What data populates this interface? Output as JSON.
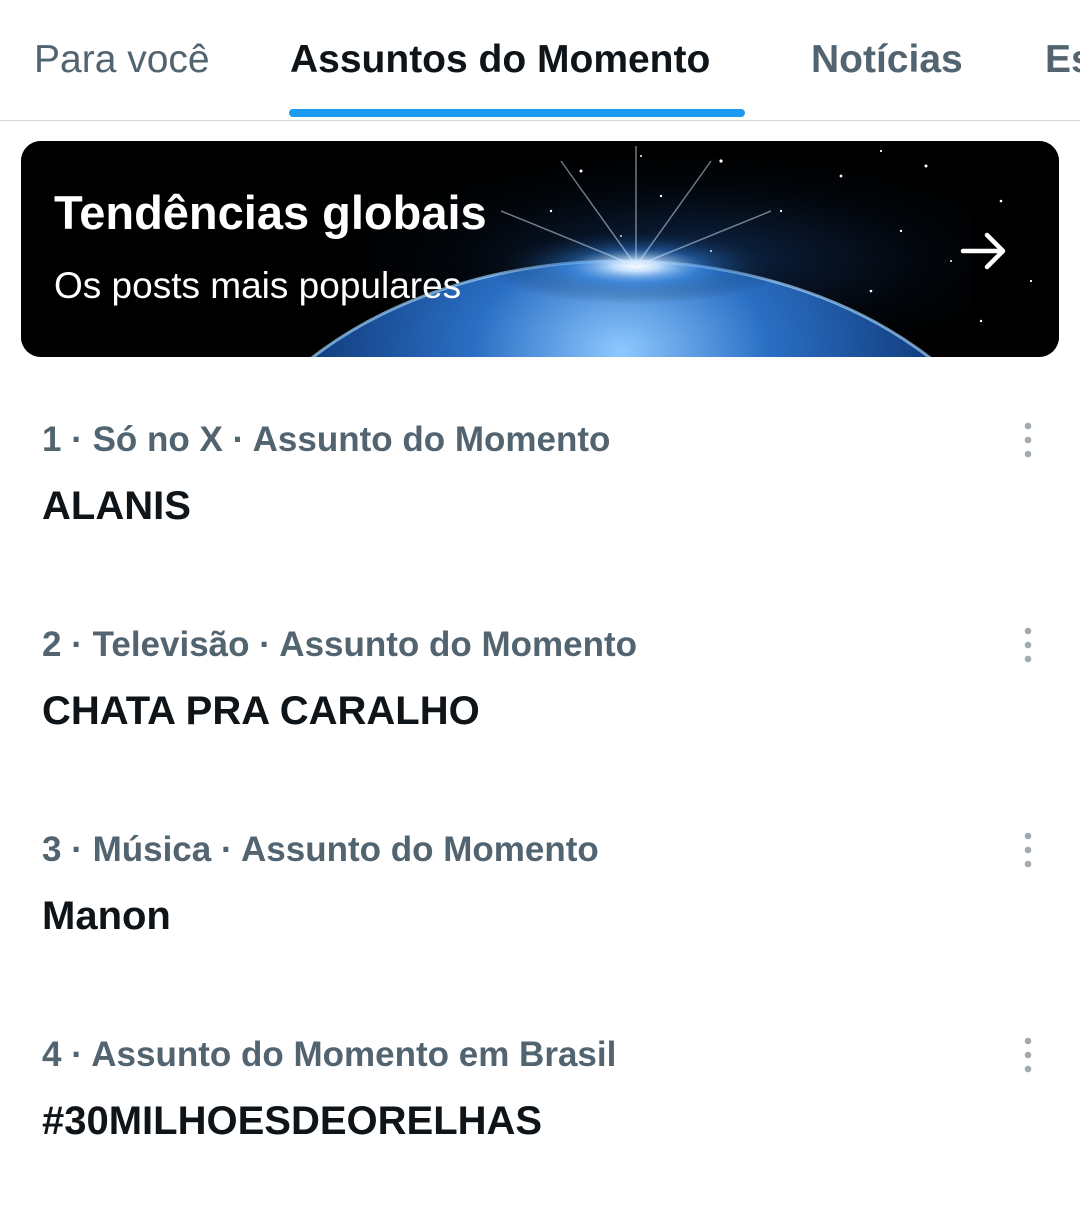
{
  "tabs": [
    {
      "label": "Para você",
      "active": false
    },
    {
      "label": "Assuntos do Momento",
      "active": true
    },
    {
      "label": "Notícias",
      "active": false
    },
    {
      "label": "Es",
      "active": false
    }
  ],
  "banner": {
    "title": "Tendências globais",
    "subtitle": "Os posts mais populares",
    "icon": "arrow-right-icon"
  },
  "trends": [
    {
      "meta": "1 · Só no X · Assunto do Momento",
      "name": "ALANIS"
    },
    {
      "meta": "2 · Televisão · Assunto do Momento",
      "name": "CHATA PRA CARALHO"
    },
    {
      "meta": "3 · Música · Assunto do Momento",
      "name": "Manon"
    },
    {
      "meta": "4 · Assunto do Momento em Brasil",
      "name": "#30MILHOESDEORELHAS"
    }
  ],
  "colors": {
    "accent": "#1d9bf0",
    "text_primary": "#0f1419",
    "text_secondary": "#536471",
    "divider": "#cfd9de"
  }
}
